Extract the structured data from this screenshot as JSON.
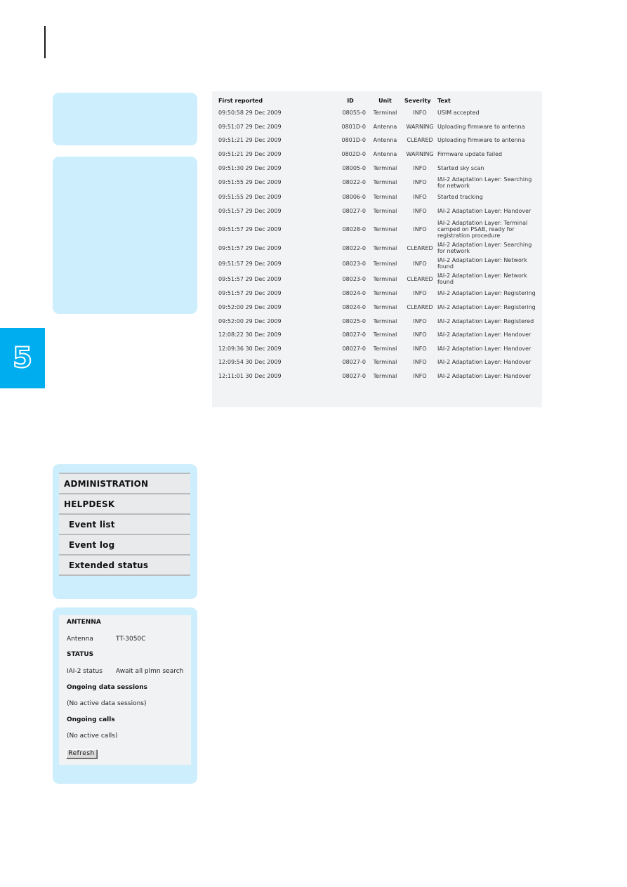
{
  "chapter": {
    "number": "5",
    "tab_color": "#00aeef"
  },
  "event_list": {
    "columns": [
      "First reported",
      "ID",
      "Unit",
      "Severity",
      "Text"
    ],
    "rows": [
      {
        "time": "09:50:58 29 Dec 2009",
        "id": "08055-0",
        "unit": "Terminal",
        "severity": "INFO",
        "text": "USIM accepted"
      },
      {
        "time": "09:51:07 29 Dec 2009",
        "id": "0801D-0",
        "unit": "Antenna",
        "severity": "WARNING",
        "text": "Uploading firmware to antenna"
      },
      {
        "time": "09:51:21 29 Dec 2009",
        "id": "0801D-0",
        "unit": "Antenna",
        "severity": "CLEARED",
        "text": "Uploading firmware to antenna"
      },
      {
        "time": "09:51:21 29 Dec 2009",
        "id": "0802D-0",
        "unit": "Antenna",
        "severity": "WARNING",
        "text": "Firmware update failed"
      },
      {
        "time": "09:51:30 29 Dec 2009",
        "id": "08005-0",
        "unit": "Terminal",
        "severity": "INFO",
        "text": "Started sky scan"
      },
      {
        "time": "09:51:55 29 Dec 2009",
        "id": "08022-0",
        "unit": "Terminal",
        "severity": "INFO",
        "text": "IAI-2 Adaptation Layer: Searching for network"
      },
      {
        "time": "09:51:55 29 Dec 2009",
        "id": "08006-0",
        "unit": "Terminal",
        "severity": "INFO",
        "text": "Started tracking"
      },
      {
        "time": "09:51:57 29 Dec 2009",
        "id": "08027-0",
        "unit": "Terminal",
        "severity": "INFO",
        "text": "IAI-2 Adaptation Layer: Handover"
      },
      {
        "time": "09:51:57 29 Dec 2009",
        "id": "08028-0",
        "unit": "Terminal",
        "severity": "INFO",
        "text": "IAI-2 Adaptation Layer: Terminal camped on PSAB, ready for registration procedure"
      },
      {
        "time": "09:51:57 29 Dec 2009",
        "id": "08022-0",
        "unit": "Terminal",
        "severity": "CLEARED",
        "text": "IAI-2 Adaptation Layer: Searching for network"
      },
      {
        "time": "09:51:57 29 Dec 2009",
        "id": "08023-0",
        "unit": "Terminal",
        "severity": "INFO",
        "text": "IAI-2 Adaptation Layer: Network found"
      },
      {
        "time": "09:51:57 29 Dec 2009",
        "id": "08023-0",
        "unit": "Terminal",
        "severity": "CLEARED",
        "text": "IAI-2 Adaptation Layer: Network found"
      },
      {
        "time": "09:51:57 29 Dec 2009",
        "id": "08024-0",
        "unit": "Terminal",
        "severity": "INFO",
        "text": "IAI-2 Adaptation Layer: Registering"
      },
      {
        "time": "09:52:00 29 Dec 2009",
        "id": "08024-0",
        "unit": "Terminal",
        "severity": "CLEARED",
        "text": "IAI-2 Adaptation Layer: Registering"
      },
      {
        "time": "09:52:00 29 Dec 2009",
        "id": "08025-0",
        "unit": "Terminal",
        "severity": "INFO",
        "text": "IAI-2 Adaptation Layer: Registered"
      },
      {
        "time": "12:08:22 30 Dec 2009",
        "id": "08027-0",
        "unit": "Terminal",
        "severity": "INFO",
        "text": "IAI-2 Adaptation Layer: Handover"
      },
      {
        "time": "12:09:36 30 Dec 2009",
        "id": "08027-0",
        "unit": "Terminal",
        "severity": "INFO",
        "text": "IAI-2 Adaptation Layer: Handover"
      },
      {
        "time": "12:09:54 30 Dec 2009",
        "id": "08027-0",
        "unit": "Terminal",
        "severity": "INFO",
        "text": "IAI-2 Adaptation Layer: Handover"
      },
      {
        "time": "12:11:01 30 Dec 2009",
        "id": "08027-0",
        "unit": "Terminal",
        "severity": "INFO",
        "text": "IAI-2 Adaptation Layer: Handover"
      }
    ]
  },
  "menu": {
    "items": [
      {
        "label": "ADMINISTRATION",
        "level": "top"
      },
      {
        "label": "HELPDESK",
        "level": "top"
      },
      {
        "label": "Event list",
        "level": "sub"
      },
      {
        "label": "Event log",
        "level": "sub"
      },
      {
        "label": "Extended status",
        "level": "sub"
      }
    ]
  },
  "extended_status": {
    "antenna_heading": "ANTENNA",
    "antenna_label": "Antenna",
    "antenna_value": "TT-3050C",
    "status_heading": "STATUS",
    "iai2_label": "IAI-2 status",
    "iai2_value": "Await all plmn search",
    "data_sessions_heading": "Ongoing data sessions",
    "data_sessions_value": "(No active data sessions)",
    "calls_heading": "Ongoing calls",
    "calls_value": "(No active calls)",
    "refresh_label": "Refresh"
  }
}
